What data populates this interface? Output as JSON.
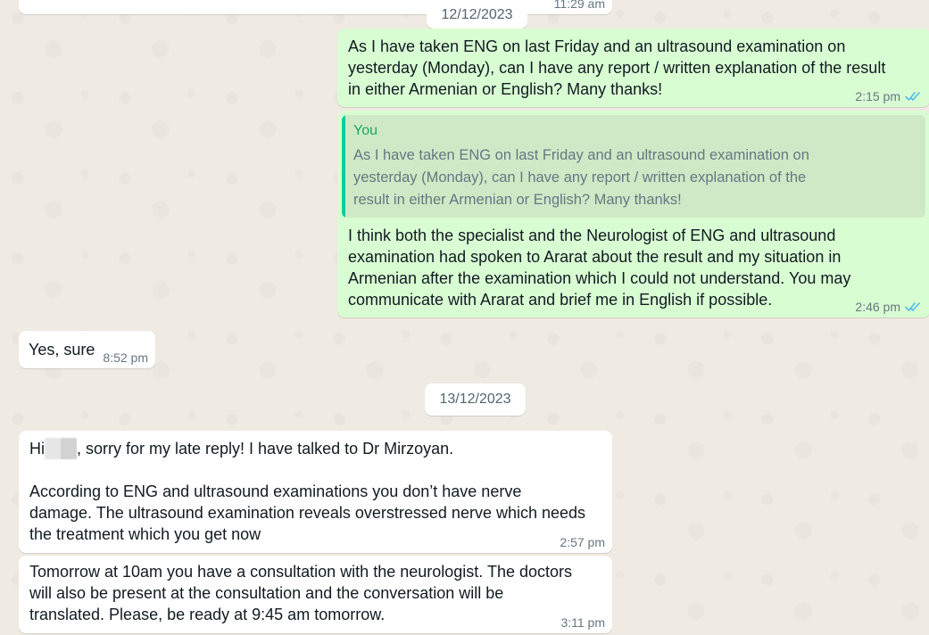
{
  "chat": {
    "top_partial_time": "11:29 am",
    "date_1": "12/12/2023",
    "date_2": "13/12/2023",
    "messages": [
      {
        "text": "As I have taken ENG on last Friday and an ultrasound examination on\nyesterday (Monday), can I have any report / written explanation of the result\nin either Armenian or English? Many thanks!",
        "time": "2:15 pm"
      },
      {
        "quote_author": "You",
        "quote_text": "As I have taken ENG on last Friday and an ultrasound examination on\nyesterday (Monday), can I have any report / written explanation of the\nresult in either Armenian or English? Many thanks!",
        "text": "I think both the specialist and the Neurologist of ENG and ultrasound\nexamination had spoken to Ararat about the result and my situation in\nArmenian after the examination which I could not understand. You may\ncommunicate with Ararat and brief me in English if possible.",
        "time": "2:46 pm"
      },
      {
        "text": "Yes, sure",
        "time": "8:52 pm"
      },
      {
        "text_prefix": "Hi",
        "text": ", sorry for my late reply! I have talked to Dr Mirzoyan.\n\nAccording to ENG and ultrasound examinations you don’t have nerve\ndamage. The ultrasound examination reveals overstressed nerve which needs\nthe treatment which you get now",
        "time": "2:57 pm"
      },
      {
        "text": "Tomorrow at 10am you have a consultation with the neurologist. The doctors\nwill also be present at the consultation and the conversation will be\ntranslated. Please, be ready at 9:45 am tomorrow.",
        "time": "3:11 pm"
      }
    ]
  },
  "colors": {
    "wallpaper": "#efeae2",
    "outgoing_bubble": "#d9fdd3",
    "incoming_bubble": "#ffffff",
    "read_ticks": "#53bdeb",
    "quote_accent": "#06cf9c"
  },
  "icons": {
    "read_receipt": "double-check-icon"
  }
}
